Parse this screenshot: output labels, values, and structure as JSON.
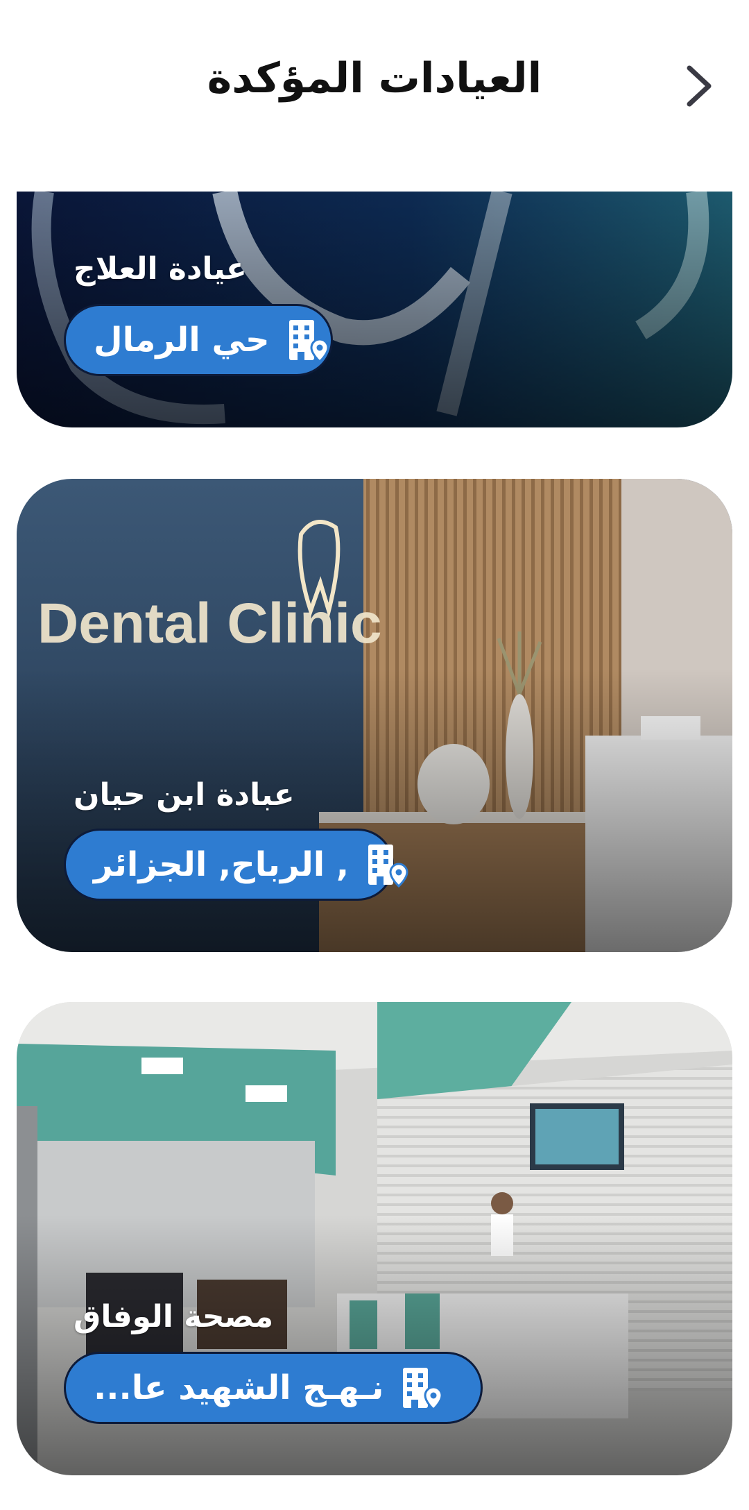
{
  "header": {
    "title": "العيادات المؤكدة",
    "back_icon": "chevron-right-icon"
  },
  "colors": {
    "accent": "#2e7cd1",
    "pill_border": "#0d1b3a",
    "title": "#111111"
  },
  "clinics": [
    {
      "name": "عيادة العلاج",
      "location": "حي الرمال",
      "icon": "building-location-icon"
    },
    {
      "name": "عبادة   ابن حيان",
      "location": ", الرباح, الجزائر",
      "icon": "building-location-icon",
      "image_text": "Dental Clinic"
    },
    {
      "name": "مصحة الوفاق",
      "location": "نـهـج الشهيد عا...",
      "icon": "building-location-icon"
    }
  ]
}
